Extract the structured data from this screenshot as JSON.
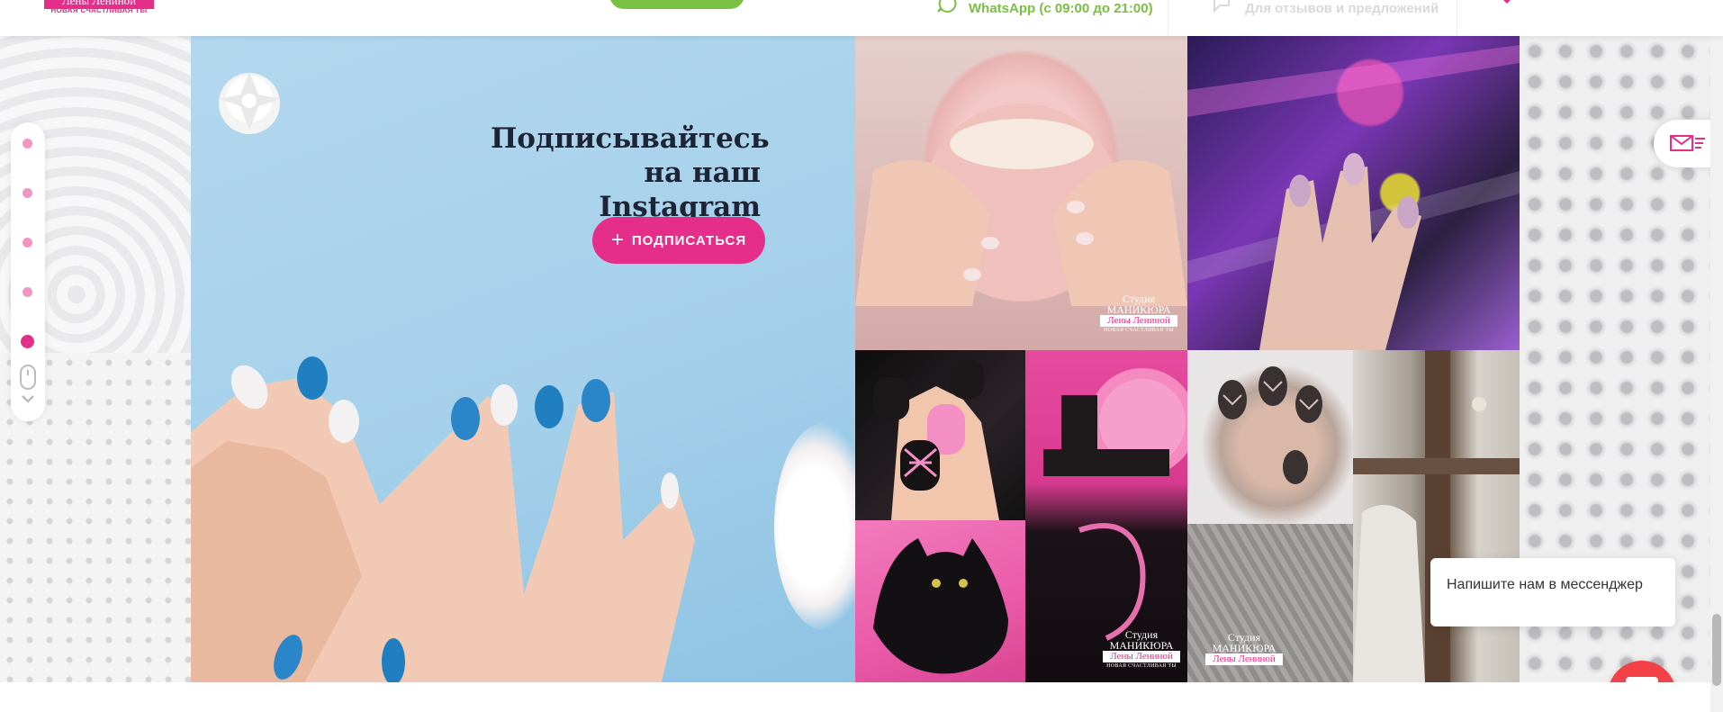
{
  "header": {
    "logo_title": "Лены Лениной",
    "logo_subtitle": "НОВАЯ СЧАСТЛИВАЯ ТЫ",
    "whatsapp_text": "WhatsApp (с 09:00 до 21:00)",
    "feedback_text": "Для отзывов и предложений",
    "colors": {
      "brand": "#e52e8a",
      "green": "#7ac043"
    }
  },
  "instagram_block": {
    "heading_line1": "Подписывайтесь",
    "heading_line2": "на наш Instagram",
    "subscribe_label": "ПОДПИСАТЬСЯ",
    "subscribe_icon": "plus-icon"
  },
  "watermark": {
    "line1": "Студия",
    "line2": "МАНИКЮРА",
    "line3": "Лены Лениной",
    "line4": "НОВАЯ СЧАСТЛИВАЯ ТЫ"
  },
  "dot_nav": {
    "active_index": 4,
    "count": 5
  },
  "chat": {
    "message": "Напишите нам в мессенджер"
  }
}
